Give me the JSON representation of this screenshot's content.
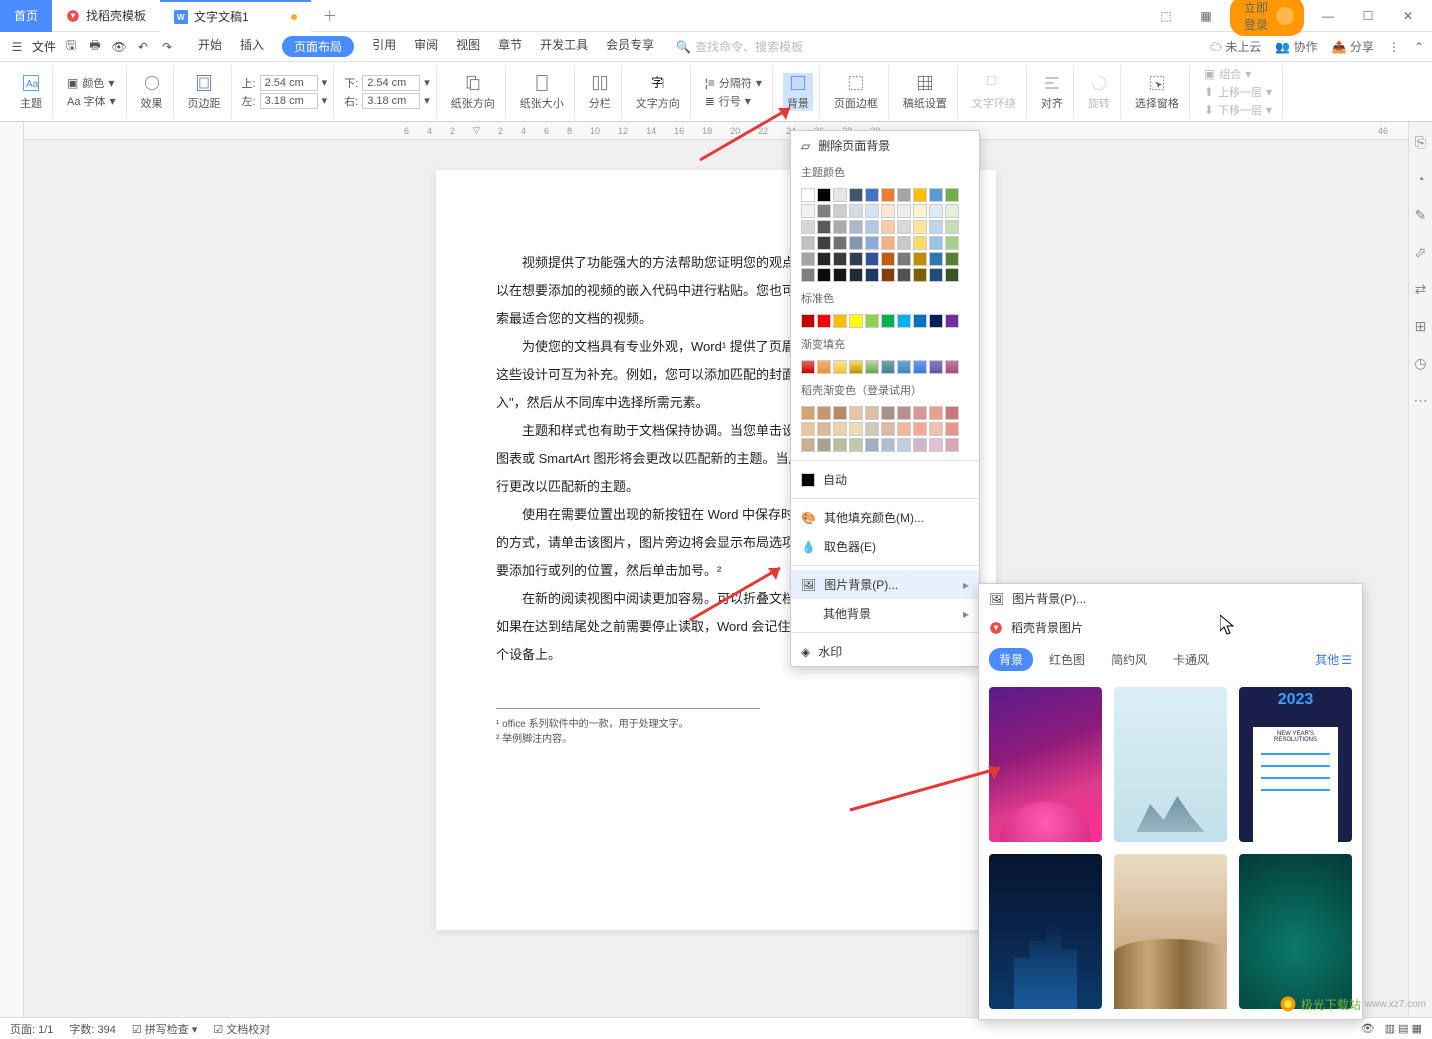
{
  "tabs": {
    "home": "首页",
    "templates": "找稻壳模板",
    "doc": "文字文稿1"
  },
  "login": "立即登录",
  "menubar": {
    "file": "文件",
    "items": [
      "开始",
      "插入",
      "页面布局",
      "引用",
      "审阅",
      "视图",
      "章节",
      "开发工具",
      "会员专享"
    ],
    "search_ph": "查找命令、搜索模板",
    "cloud": "未上云",
    "collab": "协作",
    "share": "分享"
  },
  "ribbon": {
    "theme": "主题",
    "font": "Aa 字体",
    "fontcolor": "颜色",
    "effect": "效果",
    "margin": "页边距",
    "top": "上:",
    "left": "左:",
    "btm": "下:",
    "right": "右:",
    "top_v": "2.54 cm",
    "btm_v": "2.54 cm",
    "left_v": "3.18 cm",
    "right_v": "3.18 cm",
    "orient": "纸张方向",
    "size": "纸张大小",
    "columns": "分栏",
    "textdir": "文字方向",
    "breaks": "分隔符",
    "lineno": "行号",
    "background": "背景",
    "border": "页面边框",
    "grid": "稿纸设置",
    "wrap": "文字环绕",
    "align": "对齐",
    "rotate": "旋转",
    "pane": "选择窗格",
    "group": "组合",
    "forward": "上移一层",
    "backward": "下移一层"
  },
  "ruler": [
    "6",
    "4",
    "2",
    "2",
    "4",
    "6",
    "8",
    "10",
    "12",
    "14",
    "16",
    "18",
    "20",
    "22",
    "24",
    "26",
    "28",
    "30"
  ],
  "ruler_tail": "46",
  "doc": {
    "p1": "视频提供了功能强大的方法帮助您证明您的观点。",
    "p2": "以在想要添加的视频的嵌入代码中进行粘贴。您也可以输",
    "p3": "索最适合您的文档的视频。",
    "p4": "为使您的文档具有专业外观，Word¹ 提供了页眉、页",
    "p5": "这些设计可互为补充。例如，您可以添加匹配的封面、页",
    "p6": "入\"，然后从不同库中选择所需元素。",
    "p7": "主题和样式也有助于文档保持协调。当您单击设计并",
    "p8": "图表或 SmartArt 图形将会更改以匹配新的主题。当应",
    "p9": "行更改以匹配新的主题。",
    "p10": "使用在需要位置出现的新按钮在 Word 中保存时间",
    "p11": "的方式，请单击该图片，图片旁边将会显示布局选项按钮",
    "p12": "要添加行或列的位置，然后单击加号。²",
    "p13": "在新的阅读视图中阅读更加容易。可以折叠文档某",
    "p14": "如果在达到结尾处之前需要停止读取，Word 会记住您的",
    "p15": "个设备上。",
    "fn1": "¹ office 系列软件中的一款，用于处理文字。",
    "fn2": "² 举例脚注内容。"
  },
  "bgpanel": {
    "remove": "删除页面背景",
    "theme": "主题颜色",
    "standard": "标准色",
    "gradient": "渐变填充",
    "docer": "稻壳渐变色（登录试用）",
    "auto": "自动",
    "more": "其他填充颜色(M)...",
    "picker": "取色器(E)",
    "picbg": "图片背景(P)...",
    "otherbg": "其他背景",
    "watermark": "水印"
  },
  "subpanel": {
    "picbg": "图片背景(P)...",
    "docerpic": "稻壳背景图片",
    "filters": [
      "背景",
      "红色图",
      "简约风",
      "卡通风"
    ],
    "other": "其他",
    "year": "2023",
    "resolution": "NEW YEAR'S RESOLUTIONS"
  },
  "status": {
    "page": "页面: 1/1",
    "words": "字数: 394",
    "spell": "拼写检查",
    "proof": "文档校对"
  },
  "watermark": "极光下载站"
}
